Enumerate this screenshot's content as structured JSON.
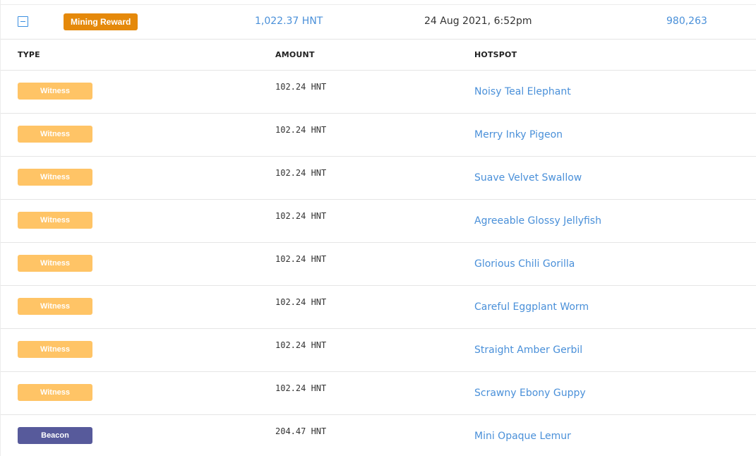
{
  "summary": {
    "type_label": "Mining Reward",
    "amount": "1,022.37 HNT",
    "date": "24 Aug 2021, 6:52pm",
    "block": "980,263",
    "collapse_icon": "minus-square-icon"
  },
  "table": {
    "headers": {
      "type": "TYPE",
      "amount": "AMOUNT",
      "hotspot": "HOTSPOT"
    },
    "rows": [
      {
        "type": "Witness",
        "amount": "102.24 HNT",
        "hotspot": "Noisy Teal Elephant"
      },
      {
        "type": "Witness",
        "amount": "102.24 HNT",
        "hotspot": "Merry Inky Pigeon"
      },
      {
        "type": "Witness",
        "amount": "102.24 HNT",
        "hotspot": "Suave Velvet Swallow"
      },
      {
        "type": "Witness",
        "amount": "102.24 HNT",
        "hotspot": "Agreeable Glossy Jellyfish"
      },
      {
        "type": "Witness",
        "amount": "102.24 HNT",
        "hotspot": "Glorious Chili Gorilla"
      },
      {
        "type": "Witness",
        "amount": "102.24 HNT",
        "hotspot": "Careful Eggplant Worm"
      },
      {
        "type": "Witness",
        "amount": "102.24 HNT",
        "hotspot": "Straight Amber Gerbil"
      },
      {
        "type": "Witness",
        "amount": "102.24 HNT",
        "hotspot": "Scrawny Ebony Guppy"
      },
      {
        "type": "Beacon",
        "amount": "204.47 HNT",
        "hotspot": "Mini Opaque Lemur"
      }
    ]
  },
  "colors": {
    "reward_badge": "#e5890a",
    "witness_badge": "#ffc466",
    "beacon_badge": "#575a9b",
    "link": "#4a90d9"
  }
}
